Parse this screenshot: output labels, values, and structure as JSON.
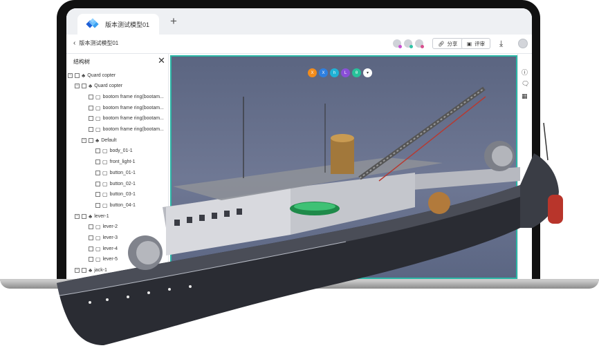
{
  "tab": {
    "title": "版本测试模型01",
    "add_label": "+"
  },
  "toolbar": {
    "back_label": "版本测试模型01",
    "share_label": "分享",
    "review_label": "评审"
  },
  "panel": {
    "title": "结构树",
    "tree": [
      {
        "label": "Quard copter",
        "level": 0,
        "kind": "assembly",
        "expander": "−"
      },
      {
        "label": "Quard copter",
        "level": 1,
        "kind": "assembly",
        "expander": "−"
      },
      {
        "label": "bootom frame ring(bootam...",
        "level": 2,
        "kind": "part"
      },
      {
        "label": "bootom frame ring(bootam...",
        "level": 2,
        "kind": "part"
      },
      {
        "label": "bootom frame ring(bootam...",
        "level": 2,
        "kind": "part"
      },
      {
        "label": "bootom frame ring(bootam...",
        "level": 2,
        "kind": "part"
      },
      {
        "label": "Default",
        "level": 2,
        "kind": "assembly",
        "expander": "−"
      },
      {
        "label": "body_01-1",
        "level": 3,
        "kind": "part"
      },
      {
        "label": "front_light-1",
        "level": 3,
        "kind": "part"
      },
      {
        "label": "button_01-1",
        "level": 3,
        "kind": "part"
      },
      {
        "label": "button_02-1",
        "level": 3,
        "kind": "part"
      },
      {
        "label": "button_03-1",
        "level": 3,
        "kind": "part"
      },
      {
        "label": "button_04-1",
        "level": 3,
        "kind": "part"
      },
      {
        "label": "lever-1",
        "level": 1,
        "kind": "assembly",
        "expander": "−"
      },
      {
        "label": "lever-2",
        "level": 2,
        "kind": "part"
      },
      {
        "label": "lever-3",
        "level": 2,
        "kind": "part"
      },
      {
        "label": "lever-4",
        "level": 2,
        "kind": "part"
      },
      {
        "label": "lever-5",
        "level": 2,
        "kind": "part"
      },
      {
        "label": "jack-1",
        "level": 1,
        "kind": "assembly",
        "expander": "−"
      }
    ]
  },
  "measure_tools": [
    {
      "label": "X",
      "color": "#f28c1c"
    },
    {
      "label": "X",
      "color": "#2e7fe0"
    },
    {
      "label": "h",
      "color": "#1fb2d6"
    },
    {
      "label": "L",
      "color": "#8a4fd8"
    },
    {
      "label": "θ",
      "color": "#27c29a"
    },
    {
      "label": "▾",
      "color": "#ffffff"
    }
  ],
  "icons": {
    "rail": [
      "info-icon",
      "comment-icon",
      "table-icon"
    ]
  },
  "colors": {
    "accent": "#2ab7a6",
    "viewport_bg": "#64708c"
  }
}
